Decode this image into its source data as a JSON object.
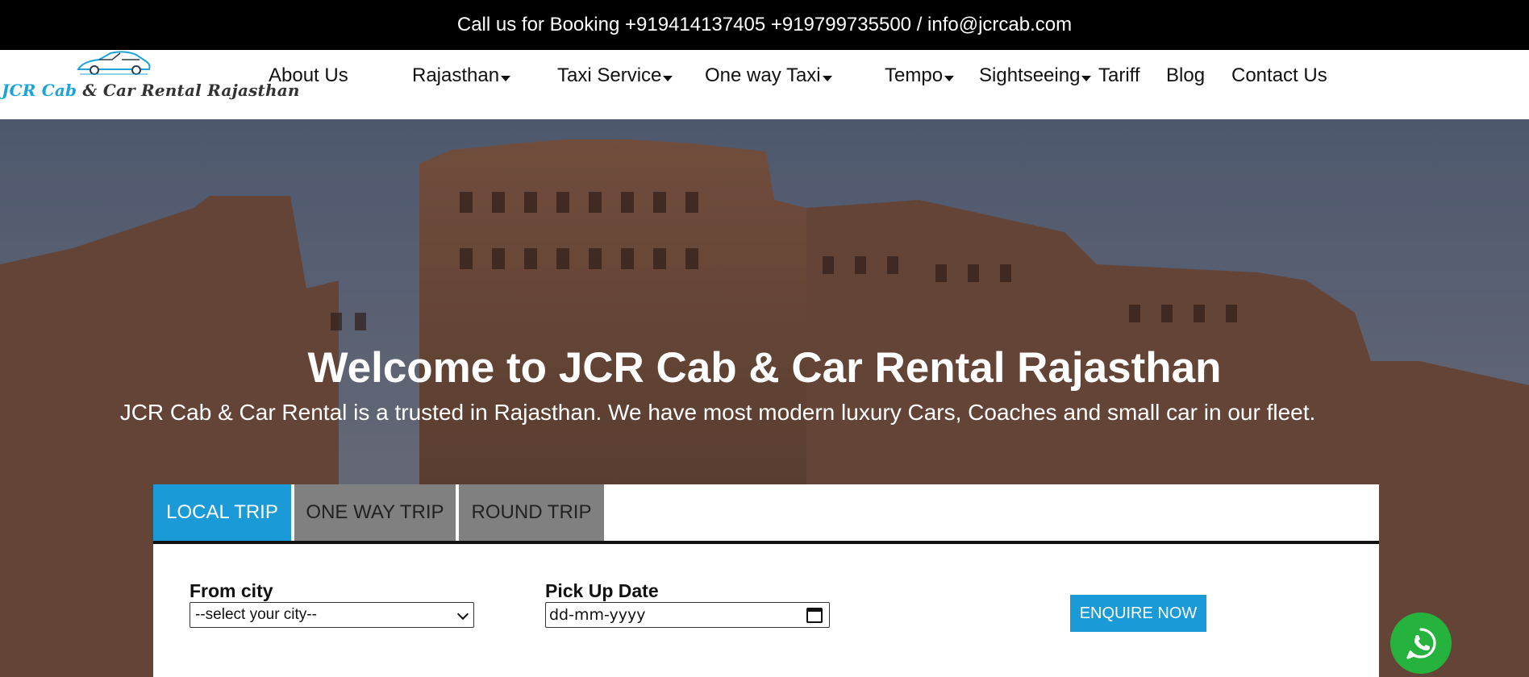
{
  "topbar": {
    "text": "Call us for Booking +919414137405 +919799735500 / info@jcrcab.com"
  },
  "logo": {
    "part1": "JCR Cab",
    "part2": "&",
    "part3": "Car Rental Rajasthan"
  },
  "nav": [
    {
      "label": "About Us",
      "dropdown": false
    },
    {
      "label": "Rajasthan",
      "dropdown": true
    },
    {
      "label": "Taxi Service",
      "dropdown": true
    },
    {
      "label": "One way Taxi",
      "dropdown": true
    },
    {
      "label": "Tempo",
      "dropdown": true
    },
    {
      "label": "Sightseeing",
      "dropdown": true
    },
    {
      "label": "Tariff",
      "dropdown": false
    },
    {
      "label": "Blog",
      "dropdown": false
    },
    {
      "label": "Contact Us",
      "dropdown": false
    }
  ],
  "hero": {
    "title": "Welcome to JCR Cab & Car Rental Rajasthan",
    "subtitle": "JCR Cab & Car Rental is a trusted in Rajasthan. We have most modern luxury Cars, Coaches and small car in our fleet."
  },
  "booking": {
    "tabs": [
      "LOCAL TRIP",
      "ONE WAY TRIP",
      "ROUND TRIP"
    ],
    "active_tab": "LOCAL TRIP",
    "from_city_label": "From city",
    "from_city_value": "--select your city--",
    "pickup_date_label": "Pick Up Date",
    "pickup_date_placeholder": "dd-mm-yyyy",
    "enquire_label": "ENQUIRE NOW"
  },
  "colors": {
    "accent": "#1a9ad6",
    "whatsapp": "#25b33d",
    "topbar": "#000000",
    "inactive_tab": "#808080"
  },
  "icons": {
    "whatsapp": "whatsapp-icon",
    "calendar": "calendar-icon",
    "dropdown": "caret-down-icon"
  }
}
